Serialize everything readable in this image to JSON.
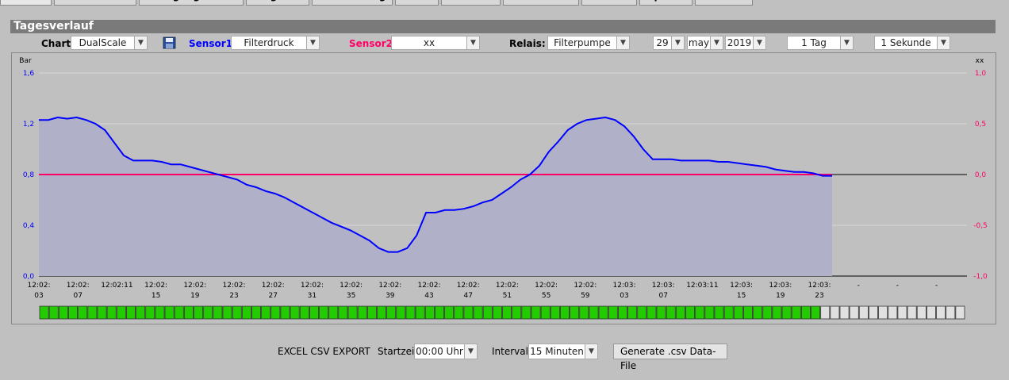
{
  "tabs": [
    "Sensor",
    "Controllsites",
    "Reinigungskurve",
    "Diagnose",
    "Kalibrierung",
    "Filter",
    "Statistik",
    "Fahrmuster",
    "Neuzeit",
    "Update",
    "SD-Card"
  ],
  "panel_title": "Tagesverlauf",
  "controls": {
    "chart_label": "Chart:",
    "chart_value": "DualScale",
    "sensor1_label": "Sensor1:",
    "sensor1_value": "Filterdruck",
    "sensor2_label": "Sensor2:",
    "sensor2_value": "xx",
    "relais_label": "Relais:",
    "relais_value": "Filterpumpe",
    "day": "29",
    "month": "may",
    "year": "2019",
    "range": "1 Tag",
    "interval": "1 Sekunde"
  },
  "colors": {
    "sensor1": "#0000ff",
    "sensor2": "#ff0066",
    "fill": "#b0b0c8",
    "progress_on": "#22cc00",
    "progress_off": "#e0e0e0"
  },
  "chart_data": {
    "type": "line",
    "left_axis": {
      "unit": "Bar",
      "ticks": [
        "0,0",
        "0,4",
        "0,8",
        "1,2",
        "1,6"
      ],
      "ylim": [
        0,
        1.6
      ]
    },
    "right_axis": {
      "unit": "xx",
      "ticks": [
        "-1,0",
        "-0,5",
        "0,0",
        "0,5",
        "1,0"
      ],
      "ylim": [
        -1,
        1
      ]
    },
    "x_labels": [
      [
        "12:02:",
        "03"
      ],
      [
        "12:02:",
        "07"
      ],
      [
        "12:02:11",
        ""
      ],
      [
        "12:02:",
        "15"
      ],
      [
        "12:02:",
        "19"
      ],
      [
        "12:02:",
        "23"
      ],
      [
        "12:02:",
        "27"
      ],
      [
        "12:02:",
        "31"
      ],
      [
        "12:02:",
        "35"
      ],
      [
        "12:02:",
        "39"
      ],
      [
        "12:02:",
        "43"
      ],
      [
        "12:02:",
        "47"
      ],
      [
        "12:02:",
        "51"
      ],
      [
        "12:02:",
        "55"
      ],
      [
        "12:02:",
        "59"
      ],
      [
        "12:03:",
        "03"
      ],
      [
        "12:03:",
        "07"
      ],
      [
        "12:03:11",
        ""
      ],
      [
        "12:03:",
        "15"
      ],
      [
        "12:03:",
        "19"
      ],
      [
        "12:03:",
        "23"
      ],
      [
        "-",
        ""
      ],
      [
        "-",
        ""
      ],
      [
        "-",
        ""
      ]
    ],
    "series": [
      {
        "axis": "left",
        "values": [
          1.23,
          1.23,
          1.25,
          1.24,
          1.25,
          1.23,
          1.2,
          1.15,
          1.05,
          0.95,
          0.91,
          0.91,
          0.91,
          0.9,
          0.88,
          0.88,
          0.86,
          0.84,
          0.82,
          0.8,
          0.78,
          0.76,
          0.72,
          0.7,
          0.67,
          0.65,
          0.62,
          0.58,
          0.54,
          0.5,
          0.46,
          0.42,
          0.39,
          0.36,
          0.32,
          0.28,
          0.22,
          0.19,
          0.19,
          0.22,
          0.32,
          0.5,
          0.5,
          0.52,
          0.52,
          0.53,
          0.55,
          0.58,
          0.6,
          0.65,
          0.7,
          0.76,
          0.8,
          0.87,
          0.98,
          1.06,
          1.15,
          1.2,
          1.23,
          1.24,
          1.25,
          1.23,
          1.18,
          1.1,
          1.0,
          0.92,
          0.92,
          0.92,
          0.91,
          0.91,
          0.91,
          0.91,
          0.9,
          0.9,
          0.89,
          0.88,
          0.87,
          0.86,
          0.84,
          0.83,
          0.82,
          0.82,
          0.81,
          0.79,
          0.79
        ]
      },
      {
        "axis": "right",
        "values": [
          0,
          0,
          0,
          0,
          0,
          0,
          0,
          0,
          0,
          0,
          0,
          0,
          0,
          0,
          0,
          0,
          0,
          0,
          0,
          0,
          0,
          0,
          0,
          0,
          0,
          0,
          0,
          0,
          0,
          0,
          0,
          0,
          0,
          0,
          0,
          0,
          0,
          0,
          0,
          0,
          0,
          0,
          0,
          0,
          0,
          0,
          0,
          0,
          0,
          0,
          0,
          0,
          0,
          0,
          0,
          0,
          0,
          0,
          0,
          0,
          0,
          0,
          0,
          0,
          0,
          0,
          0,
          0,
          0,
          0,
          0,
          0,
          0,
          0,
          0,
          0,
          0,
          0,
          0,
          0,
          0,
          0,
          0,
          0,
          0
        ]
      }
    ],
    "progress": {
      "filled": 81,
      "total": 96
    }
  },
  "export": {
    "title": "EXCEL CSV EXPORT",
    "start_label": "Startzeit:",
    "start_value": "00:00 Uhr",
    "interval_label": "Intervall:",
    "interval_value": "15 Minuten",
    "button": "Generate .csv Data-File"
  }
}
